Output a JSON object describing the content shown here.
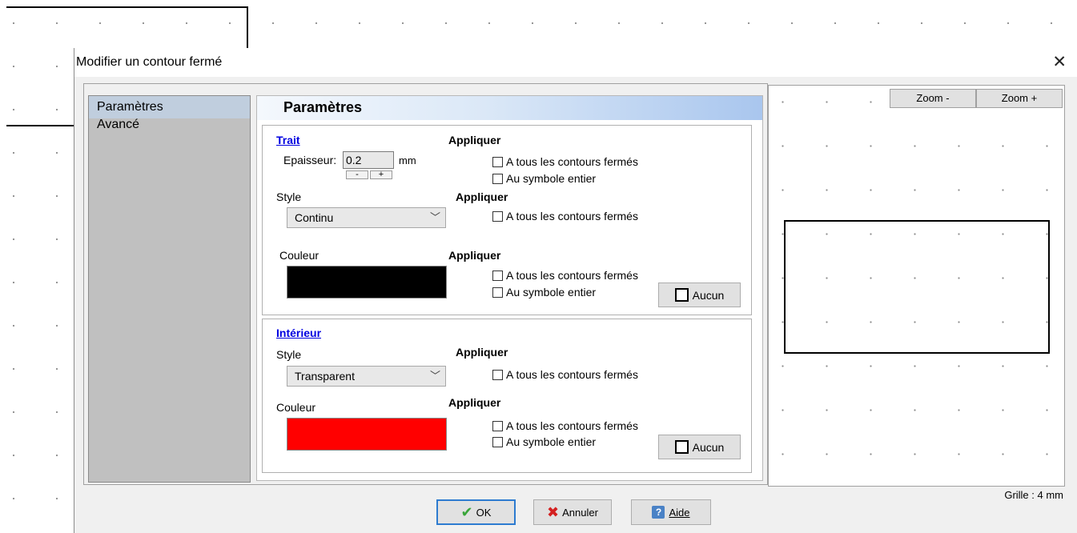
{
  "dialog": {
    "title": "Modifier un contour fermé",
    "close_glyph": "✕"
  },
  "nav": {
    "items": [
      {
        "label": "Paramètres",
        "active": true
      },
      {
        "label": "Avancé",
        "active": false
      }
    ]
  },
  "content": {
    "title": "Paramètres"
  },
  "trait": {
    "title": "Trait",
    "apply_label": "Appliquer",
    "thickness_label": "Epaisseur:",
    "thickness_value": "0.2",
    "thickness_unit": "mm",
    "spin_minus": "-",
    "spin_plus": "+",
    "check_all_contours": "A tous les contours fermés",
    "check_whole_symbol": "Au symbole entier",
    "style_label": "Style",
    "style_apply_label": "Appliquer",
    "style_value": "Continu",
    "style_check_all": "A tous les contours fermés",
    "color_label": "Couleur",
    "color_apply_label": "Appliquer",
    "color_value": "#000000",
    "color_check_all": "A tous les contours fermés",
    "color_check_symbol": "Au symbole entier",
    "none_button": "Aucun"
  },
  "interieur": {
    "title": "Intérieur",
    "style_label": "Style",
    "style_apply_label": "Appliquer",
    "style_value": "Transparent",
    "style_check_all": "A tous les contours fermés",
    "color_label": "Couleur",
    "color_apply_label": "Appliquer",
    "color_value": "#ff0000",
    "color_check_all": "A tous les contours fermés",
    "color_check_symbol": "Au symbole entier",
    "none_button": "Aucun"
  },
  "preview": {
    "zoom_out": "Zoom -",
    "zoom_in": "Zoom +",
    "grid_label": "Grille : 4 mm"
  },
  "footer": {
    "ok": "OK",
    "cancel": "Annuler",
    "help": "Aide"
  },
  "icons": {
    "ok": "check-icon",
    "cancel": "x-icon",
    "help": "help-icon",
    "chevron": "chevron-down-icon"
  },
  "colors": {
    "accent": "#2d7bd0",
    "nav_selected": "#c0cede",
    "link": "#0000e0"
  }
}
